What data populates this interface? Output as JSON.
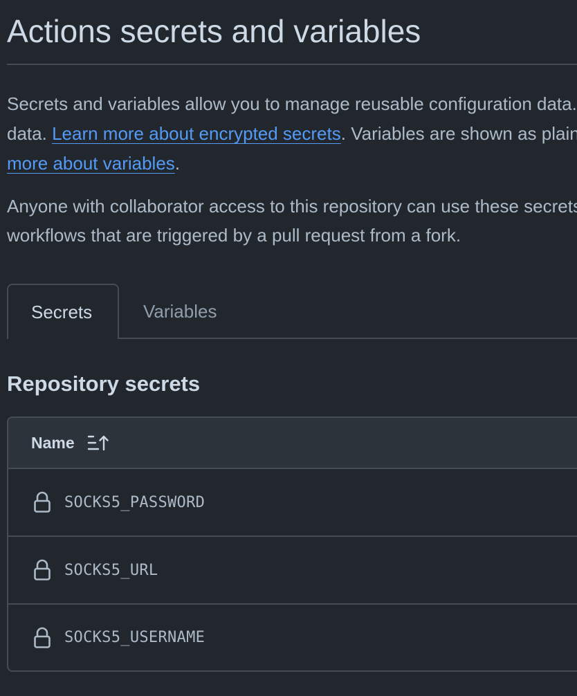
{
  "header": {
    "title": "Actions secrets and variables"
  },
  "description": {
    "p1_text_a": "Secrets and variables allow you to manage reusable configuration data. Secrets are encrypted and are used for sensitive",
    "p1_line1": "Secrets and variables allow you to manage reusable configuration data. Secrets are encrypted and are used for sensitive",
    "p1_line2_before": "data. ",
    "link_secrets": "Learn more about encrypted secrets",
    "p1_line2_after": ". Variables are shown as plain text and are used for non-sensitive data. Learn",
    "link_variables": "more about variables",
    "p1_end": ".",
    "p2_line1": "Anyone with collaborator access to this repository can use these secrets and variables for actions. They are not passed to",
    "p2_line2": "workflows that are triggered by a pull request from a fork."
  },
  "tabs": [
    {
      "label": "Secrets",
      "active": true
    },
    {
      "label": "Variables",
      "active": false
    }
  ],
  "section": {
    "title": "Repository secrets"
  },
  "table": {
    "column_header": "Name",
    "sort_icon": "sort-ascending-icon",
    "rows": [
      {
        "icon": "lock-icon",
        "name": "SOCKS5_PASSWORD"
      },
      {
        "icon": "lock-icon",
        "name": "SOCKS5_URL"
      },
      {
        "icon": "lock-icon",
        "name": "SOCKS5_USERNAME"
      }
    ]
  },
  "colors": {
    "background": "#22272e",
    "text": "#adbac7",
    "heading": "#cdd9e5",
    "link": "#539bf5",
    "border": "#444c56",
    "header_bg": "#2d333b"
  }
}
